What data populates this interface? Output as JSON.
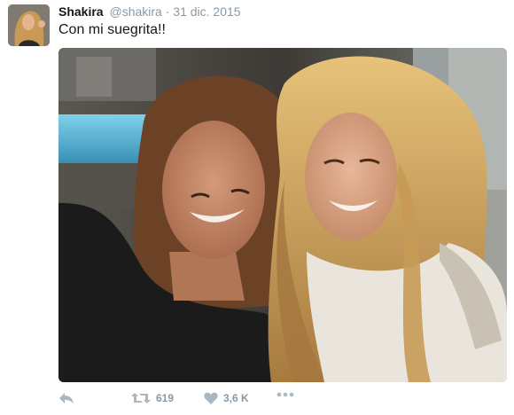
{
  "tweet": {
    "name": "Shakira",
    "handle": "@shakira",
    "separator": "·",
    "date": "31 dic. 2015",
    "text": "Con mi suegrita!!"
  },
  "actions": {
    "reply_icon": "reply-icon",
    "retweet_icon": "retweet-icon",
    "retweet_count": "619",
    "like_icon": "heart-icon",
    "like_count": "3,6 K",
    "more_icon": "more-dots-icon"
  },
  "colors": {
    "name": "#14171a",
    "secondary_text": "#8899a6",
    "action_icon": "#aab8c2"
  }
}
